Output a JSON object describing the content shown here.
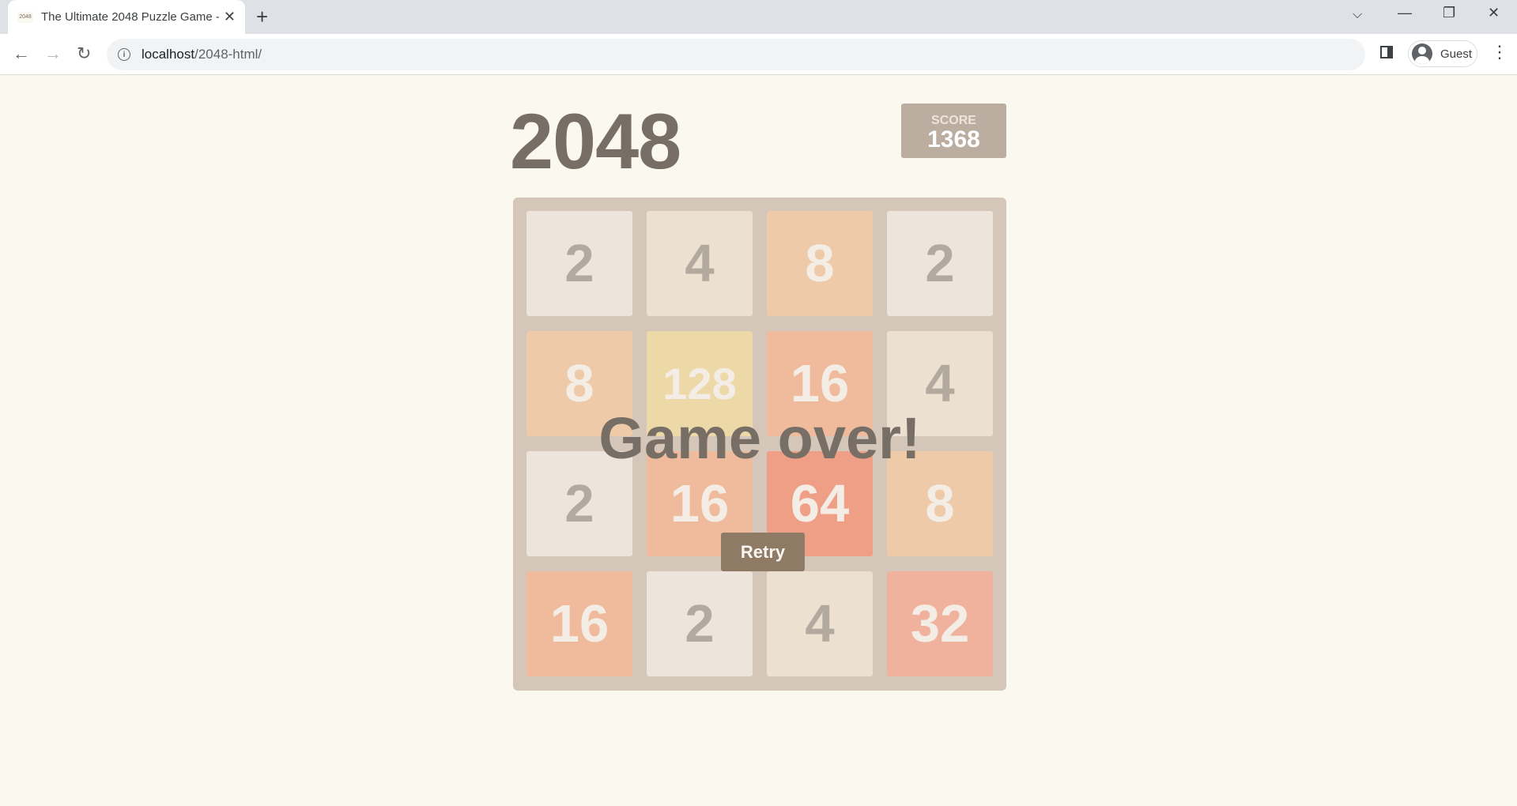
{
  "browser": {
    "tab_title": "The Ultimate 2048 Puzzle Game - ",
    "favicon_text": "2048",
    "url_host": "localhost",
    "url_path": "/2048-html/",
    "profile": "Guest"
  },
  "game": {
    "title": "2048",
    "score_label": "SCORE",
    "score": "1368",
    "message": "Game over!",
    "retry_label": "Retry",
    "grid": [
      [
        2,
        4,
        8,
        2
      ],
      [
        8,
        128,
        16,
        4
      ],
      [
        2,
        16,
        64,
        8
      ],
      [
        16,
        2,
        4,
        32
      ]
    ]
  },
  "colors": {
    "board": "#d4c6b9",
    "tile_2": "#ede4db",
    "tile_4": "#ece0d0",
    "tile_8": "#eecaa9",
    "tile_16": "#f0bb9d",
    "tile_32": "#f0b19d",
    "tile_64": "#f09f87",
    "tile_128": "#edd9a8",
    "text_dark": "#b3aa9f",
    "text_light": "#f3ede6",
    "accent": "#8f7a66"
  }
}
